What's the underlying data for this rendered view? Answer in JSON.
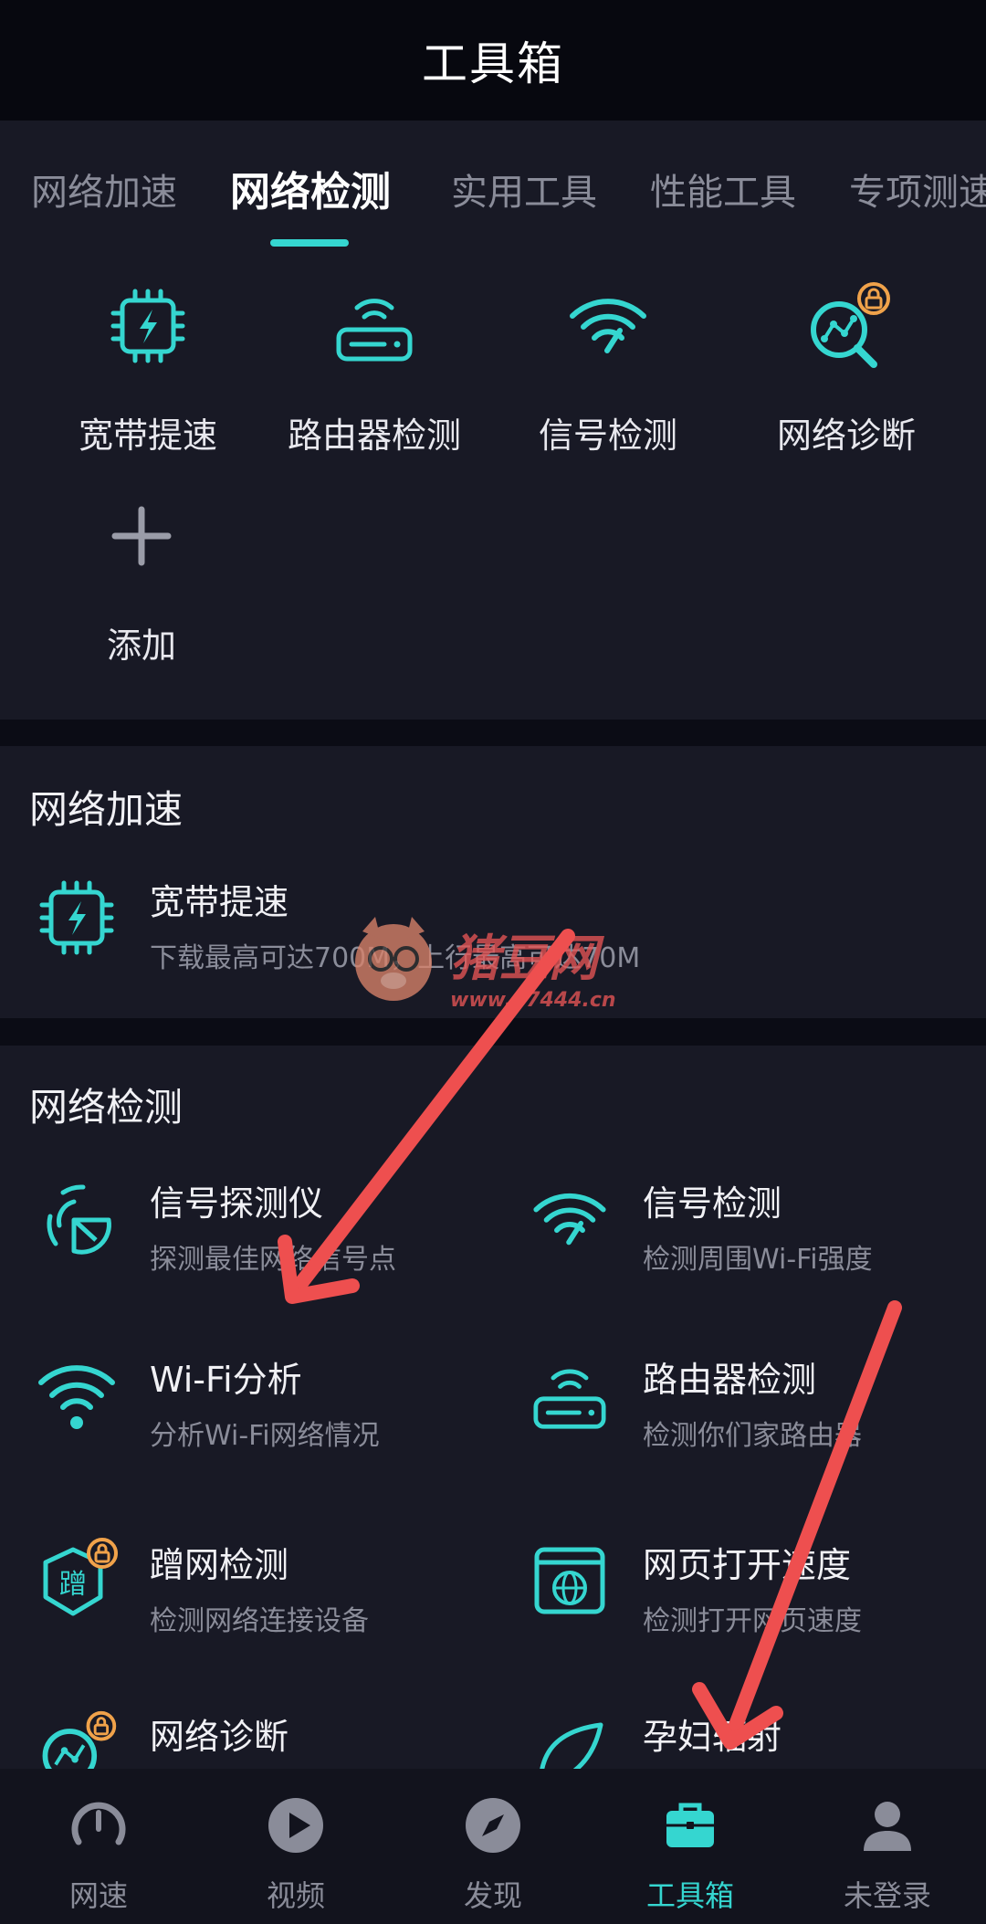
{
  "app": {
    "title": "工具箱"
  },
  "tabs": [
    "网络加速",
    "网络检测",
    "实用工具",
    "性能工具",
    "专项测速"
  ],
  "active_tab": 1,
  "quick_tools": [
    {
      "label": "宽带提速",
      "icon": "chip-bolt-icon"
    },
    {
      "label": "路由器检测",
      "icon": "router-icon"
    },
    {
      "label": "信号检测",
      "icon": "wifi-signal-icon"
    },
    {
      "label": "网络诊断",
      "icon": "network-diagnose-icon",
      "locked": true
    },
    {
      "label": "添加",
      "icon": "plus-icon"
    }
  ],
  "section_accel": {
    "title": "网络加速",
    "items": [
      {
        "title": "宽带提速",
        "desc": "下载最高可达700M，上行最高可达70M",
        "icon": "chip-bolt-icon"
      }
    ]
  },
  "section_detect": {
    "title": "网络检测",
    "items": [
      {
        "title": "信号探测仪",
        "desc": "探测最佳网络信号点",
        "icon": "radar-icon"
      },
      {
        "title": "信号检测",
        "desc": "检测周围Wi-Fi强度",
        "icon": "wifi-signal-icon"
      },
      {
        "title": "Wi-Fi分析",
        "desc": "分析Wi-Fi网络情况",
        "icon": "wifi-icon"
      },
      {
        "title": "路由器检测",
        "desc": "检测你们家路由器",
        "icon": "router-icon"
      },
      {
        "title": "蹭网检测",
        "desc": "检测网络连接设备",
        "icon": "shield-cheng-icon",
        "glyph": "蹭",
        "locked": true
      },
      {
        "title": "网页打开速度",
        "desc": "检测打开网页速度",
        "icon": "web-globe-icon"
      },
      {
        "title": "网络诊断",
        "desc": "",
        "icon": "network-diagnose-icon",
        "locked": true
      },
      {
        "title": "孕妇辐射",
        "desc": "",
        "icon": "leaf-icon"
      }
    ]
  },
  "watermark": {
    "brand": "猪豆网",
    "url": "www.97444.cn"
  },
  "nav": [
    {
      "label": "网速",
      "icon": "speedometer-icon"
    },
    {
      "label": "视频",
      "icon": "play-icon"
    },
    {
      "label": "发现",
      "icon": "compass-icon"
    },
    {
      "label": "工具箱",
      "icon": "toolbox-icon"
    },
    {
      "label": "未登录",
      "icon": "user-icon"
    }
  ],
  "active_nav": 3,
  "colors": {
    "accent": "#35d6d0",
    "lock": "#f0a24a",
    "annotation_arrow": "#ee4f4f"
  }
}
